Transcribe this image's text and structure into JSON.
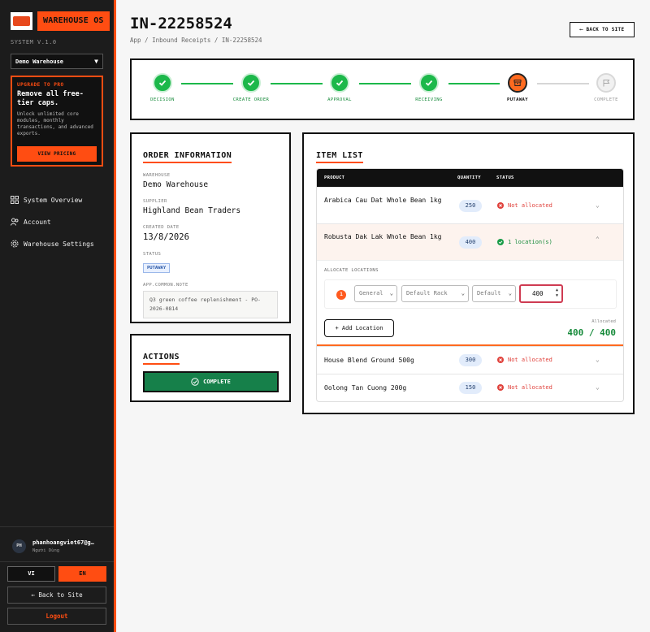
{
  "sidebar": {
    "brand": "WAREHOUSE OS",
    "version": "SYSTEM V.1.0",
    "warehouse_select": "Demo Warehouse",
    "upgrade": {
      "tag": "UPGRADE TO PRO",
      "title": "Remove all free-tier caps.",
      "desc": "Unlock unlimited core modules, monthly transactions, and advanced exports.",
      "button": "VIEW PRICING"
    },
    "nav": [
      {
        "label": "System Overview",
        "icon": "grid-icon"
      },
      {
        "label": "Account",
        "icon": "users-icon"
      },
      {
        "label": "Warehouse Settings",
        "icon": "gear-icon"
      }
    ],
    "user": {
      "initials": "PH",
      "name": "phanhoangviet67@g…",
      "role": "Người Dùng"
    },
    "lang_vi": "VI",
    "lang_en": "EN",
    "back_to_site": "← Back to Site",
    "logout": "Logout"
  },
  "header": {
    "title": "IN-22258524",
    "breadcrumb": "App / Inbound Receipts / IN-22258524",
    "back_button": "BACK TO SITE"
  },
  "steps": [
    {
      "label": "DECISION",
      "state": "done"
    },
    {
      "label": "CREATE ORDER",
      "state": "done"
    },
    {
      "label": "APPROVAL",
      "state": "done"
    },
    {
      "label": "RECEIVING",
      "state": "done"
    },
    {
      "label": "PUTAWAY",
      "state": "active"
    },
    {
      "label": "COMPLETE",
      "state": "pending"
    }
  ],
  "order_info": {
    "title": "ORDER INFORMATION",
    "warehouse_label": "WAREHOUSE",
    "warehouse": "Demo Warehouse",
    "supplier_label": "SUPPLIER",
    "supplier": "Highland Bean Traders",
    "created_label": "CREATED DATE",
    "created": "13/8/2026",
    "status_label": "STATUS",
    "status": "PUTAWAY",
    "note_label": "APP.COMMON.NOTE",
    "note": "Q3 green coffee replenishment - PO-2026-0814"
  },
  "actions": {
    "title": "ACTIONS",
    "complete": "COMPLETE"
  },
  "items": {
    "title": "ITEM LIST",
    "headers": {
      "product": "PRODUCT",
      "quantity": "QUANTITY",
      "status": "STATUS"
    },
    "rows": [
      {
        "name": "Arabica Cau Dat Whole Bean 1kg",
        "qty": "250",
        "status": "Not allocated",
        "ok": false
      },
      {
        "name": "Robusta Dak Lak Whole Bean 1kg",
        "qty": "400",
        "status": "1 location(s)",
        "ok": true
      },
      {
        "name": "House Blend Ground 500g",
        "qty": "300",
        "status": "Not allocated",
        "ok": false
      },
      {
        "name": "Oolong Tan Cuong 200g",
        "qty": "150",
        "status": "Not allocated",
        "ok": false
      }
    ],
    "allocate": {
      "label": "ALLOCATE LOCATIONS",
      "index": "1",
      "zone": "General",
      "rack": "Default Rack",
      "bin": "Default",
      "qty": "400",
      "add_button": "+ Add Location",
      "allocated_label": "Allocated",
      "allocated_value": "400 / 400"
    }
  },
  "colors": {
    "accent": "#ff4d12",
    "success": "#1cb84a",
    "danger": "#e0413b"
  }
}
